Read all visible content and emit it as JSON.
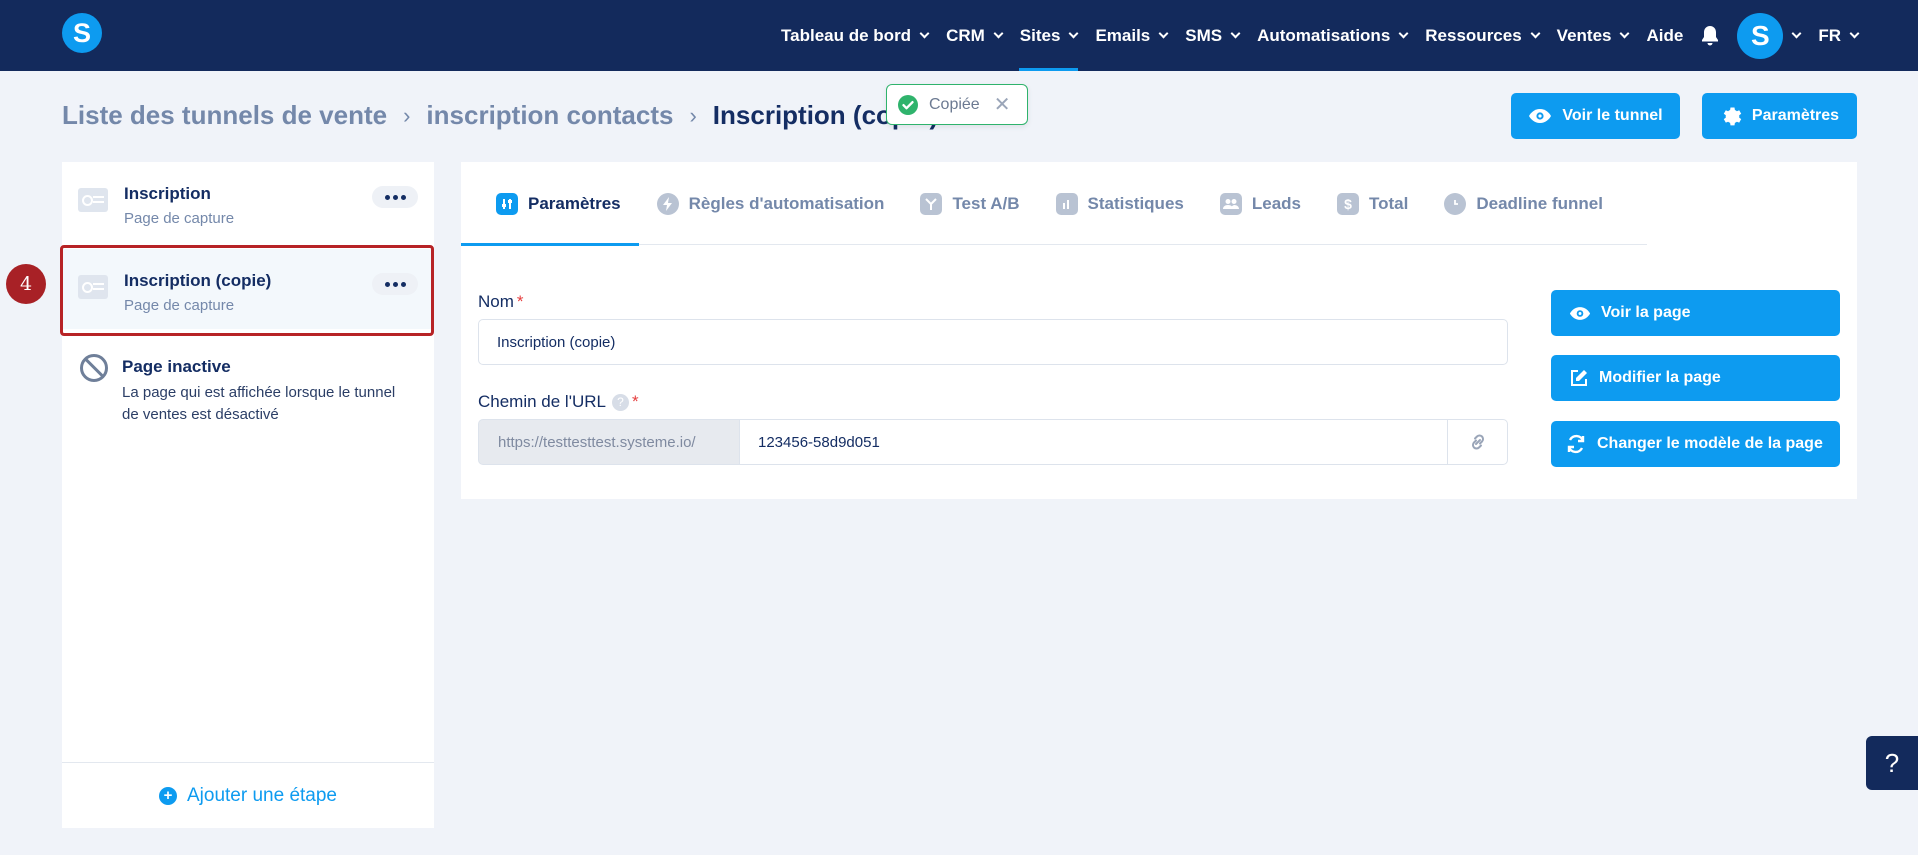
{
  "app": {
    "logo_letter": "S"
  },
  "nav": {
    "items": [
      {
        "label": "Tableau de bord",
        "has_menu": true,
        "active": false
      },
      {
        "label": "CRM",
        "has_menu": true,
        "active": false
      },
      {
        "label": "Sites",
        "has_menu": true,
        "active": true
      },
      {
        "label": "Emails",
        "has_menu": true,
        "active": false
      },
      {
        "label": "SMS",
        "has_menu": true,
        "active": false
      },
      {
        "label": "Automatisations",
        "has_menu": true,
        "active": false
      },
      {
        "label": "Ressources",
        "has_menu": true,
        "active": false
      },
      {
        "label": "Ventes",
        "has_menu": true,
        "active": false
      },
      {
        "label": "Aide",
        "has_menu": false,
        "active": false
      }
    ],
    "avatar_letter": "S",
    "language": "FR"
  },
  "breadcrumb": {
    "items": [
      "Liste des tunnels de vente",
      "inscription contacts"
    ],
    "current": "Inscription (copie)"
  },
  "toast": {
    "text": "Copiée",
    "status_color": "#2fb36c"
  },
  "header_actions": {
    "view_funnel": "Voir le tunnel",
    "settings": "Paramètres"
  },
  "sidebar": {
    "steps": [
      {
        "title": "Inscription",
        "subtitle": "Page de capture"
      },
      {
        "title": "Inscription (copie)",
        "subtitle": "Page de capture",
        "selected": true
      }
    ],
    "inactive": {
      "title": "Page inactive",
      "description": "La page qui est affichée lorsque le tunnel de ventes est désactivé"
    },
    "add_step": "Ajouter une étape",
    "annotation_number": "4"
  },
  "tabs": [
    {
      "label": "Paramètres",
      "icon": "sliders-icon",
      "active": true
    },
    {
      "label": "Règles d'automatisation",
      "icon": "bolt-icon",
      "active": false
    },
    {
      "label": "Test A/B",
      "icon": "split-icon",
      "active": false
    },
    {
      "label": "Statistiques",
      "icon": "bar-chart-icon",
      "active": false
    },
    {
      "label": "Leads",
      "icon": "users-icon",
      "active": false
    },
    {
      "label": "Total",
      "icon": "dollar-icon",
      "active": false
    },
    {
      "label": "Deadline funnel",
      "icon": "clock-icon",
      "active": false
    }
  ],
  "form": {
    "name_label": "Nom",
    "name_value": "Inscription (copie)",
    "url_label": "Chemin de l'URL",
    "url_prefix": "https://testtesttest.systeme.io/",
    "url_value": "123456-58d9d051"
  },
  "page_actions": {
    "view_page": "Voir la page",
    "edit_page": "Modifier la page",
    "change_template": "Changer le modèle de la page"
  },
  "help_fab": "?",
  "colors": {
    "accent": "#0d9bf0",
    "nav_bg": "#132a5c",
    "highlight": "#b72326"
  }
}
